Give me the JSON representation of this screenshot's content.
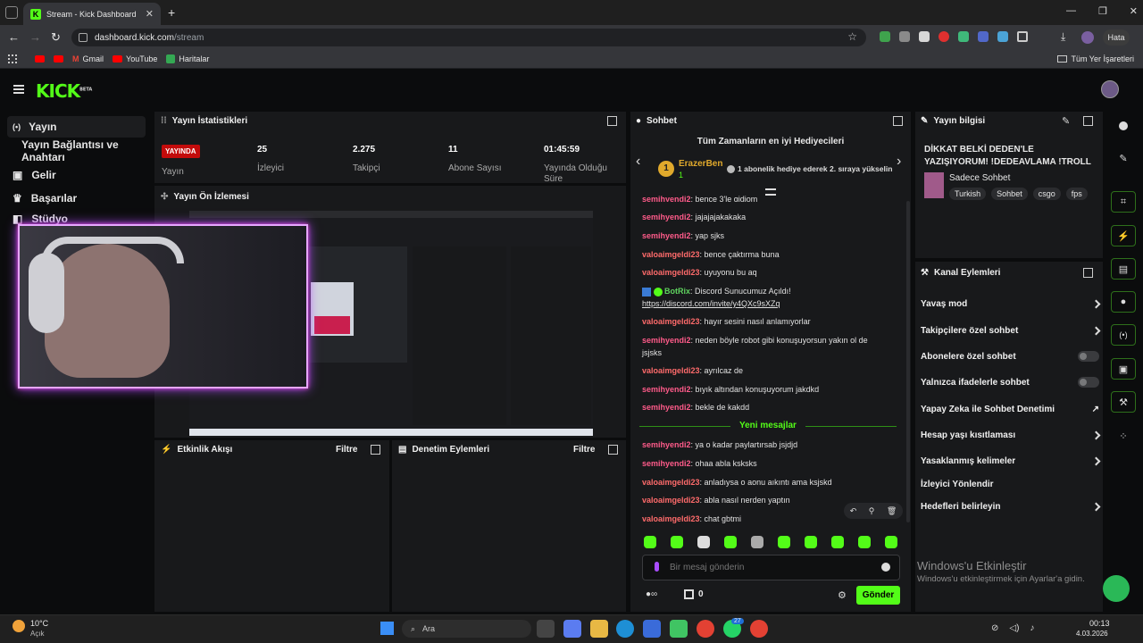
{
  "browser": {
    "tab_title": "Stream - Kick Dashboard",
    "url_host": "dashboard.kick.com",
    "url_path": "/stream",
    "profile_label": "Hata",
    "bookmarks": [
      "Gmail",
      "YouTube",
      "Haritalar"
    ],
    "other_bookmarks": "Tüm Yer İşaretleri"
  },
  "brand": {
    "logo": "KICK",
    "beta": "BETA",
    "accent": "#53fc18"
  },
  "sidebar": {
    "items": [
      {
        "label": "Yayın"
      },
      {
        "label": "Yayın Bağlantısı ve Anahtarı"
      },
      {
        "label": "Gelir"
      },
      {
        "label": "Başarılar"
      },
      {
        "label": "Stüdyo"
      }
    ]
  },
  "stats": {
    "title": "Yayın İstatistikleri",
    "live_badge": "YAYINDA",
    "live_label": "Yayın",
    "viewers": {
      "value": "25",
      "label": "İzleyici"
    },
    "followers": {
      "value": "2.275",
      "label": "Takipçi"
    },
    "subs": {
      "value": "11",
      "label": "Abone Sayısı"
    },
    "uptime": {
      "value": "01:45:59",
      "label": "Yayında Olduğu Süre"
    }
  },
  "preview": {
    "title": "Yayın Ön İzlemesi"
  },
  "activity": {
    "title": "Etkinlik Akışı",
    "filter": "Filtre"
  },
  "moderation": {
    "title": "Denetim Eylemleri",
    "filter": "Filtre"
  },
  "chat": {
    "title": "Sohbet",
    "gifters_title": "Tüm Zamanların en iyi Hediyecileri",
    "top_gifter": {
      "name": "ErazerBen",
      "rank": "1",
      "count": "1"
    },
    "gifter_note": "1 abonelik hediye ederek 2. sıraya yükselin",
    "messages": [
      {
        "user": "semihyendi2",
        "text": ": bence 3'le gidiom"
      },
      {
        "user": "semihyendi2",
        "text": ": jajajajakakaka"
      },
      {
        "user": "semihyendi2",
        "text": ": yap sjks"
      },
      {
        "user": "valoaimgeldi23",
        "text": ": bence çaktırma buna"
      },
      {
        "user": "valoaimgeldi23",
        "text": ": uyuyonu bu aq"
      },
      {
        "user": "BotRix",
        "text": ": Discord Sunucumuz Açıldı!",
        "link": "https://discord.com/invite/y4QXc9sXZq"
      },
      {
        "user": "valoaimgeldi23",
        "text": ": hayır sesini nasıl anlamıyorlar"
      },
      {
        "user": "semihyendi2",
        "text": ": neden böyle robot gibi konuşuyorsun yakın ol de jsjsks"
      },
      {
        "user": "valoaimgeldi23",
        "text": ": ayrılcaz de"
      },
      {
        "user": "semihyendi2",
        "text": ": bıyık altından konuşuyorum jakdkd"
      },
      {
        "user": "semihyendi2",
        "text": ": bekle de kakdd"
      },
      {
        "user": "semihyendi2",
        "text": ": ya o kadar paylartırsab jsjdjd"
      },
      {
        "user": "semihyendi2",
        "text": ": ohaa abla ksksks"
      },
      {
        "user": "valoaimgeldi23",
        "text": ": anladıysa o aonu aıkıntı ama ksjskd"
      },
      {
        "user": "valoaimgeldi23",
        "text": ": abla nasıl nerden yaptın"
      },
      {
        "user": "valoaimgeldi23",
        "text": ": chat gbtmi"
      }
    ],
    "new_messages": "Yeni mesajlar",
    "input_placeholder": "Bir mesaj gönderin",
    "points": "0",
    "send": "Gönder"
  },
  "stream_info": {
    "title": "Yayın bilgisi",
    "stream_title": "DİKKAT BELKİ DEDEN'LE YAZIŞIYORUM! !DEDEAVLAMA !TROLL",
    "category": "Sadece Sohbet",
    "tags": [
      "Turkish",
      "Sohbet",
      "csgo",
      "fps"
    ]
  },
  "channel_actions": {
    "title": "Kanal Eylemleri",
    "items": [
      "Yavaş mod",
      "Takipçilere özel sohbet",
      "Abonelere özel sohbet",
      "Yalnızca ifadelerle sohbet",
      "Yapay Zeka ile Sohbet Denetimi",
      "Hesap yaşı kısıtlaması",
      "Yasaklanmış kelimeler",
      "İzleyici Yönlendir",
      "Hedefleri belirleyin"
    ]
  },
  "watermark": {
    "title": "Windows'u Etkinleştir",
    "subtitle": "Windows'u etkinleştirmek için Ayarlar'a gidin."
  },
  "taskbar": {
    "weather_temp": "10°C",
    "weather_desc": "Açık",
    "search": "Ara",
    "time": "00:13",
    "date": "4.03.2026",
    "badge": "27"
  }
}
